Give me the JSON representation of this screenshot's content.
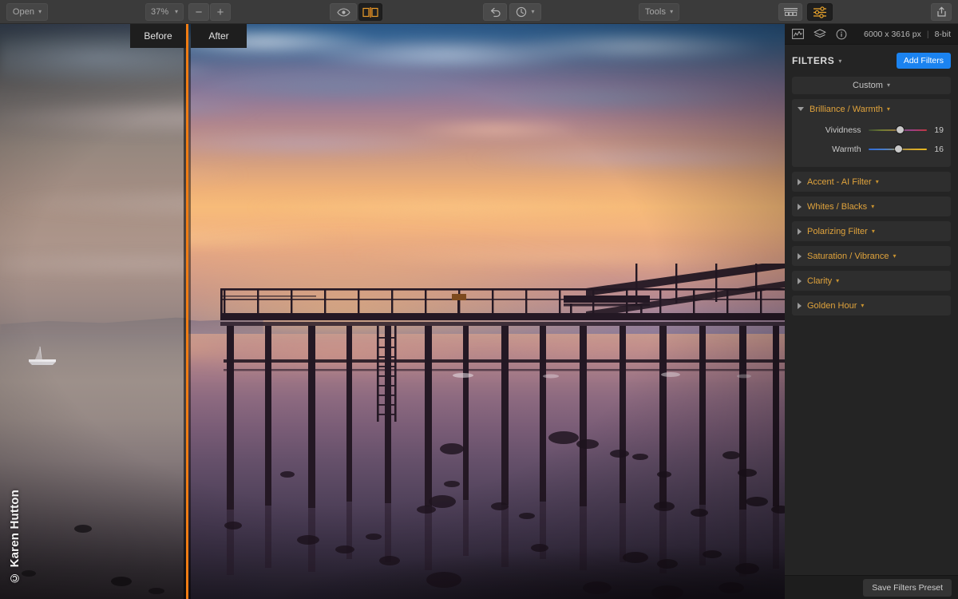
{
  "toolbar": {
    "open_label": "Open",
    "zoom_level": "37%",
    "zoom_out_label": "−",
    "zoom_in_label": "+",
    "preview_icon": "eye-icon",
    "compare_icon": "before-after-compare-icon",
    "undo_icon": "undo-arrow-icon",
    "history_icon": "history-clock-icon",
    "tools_label": "Tools",
    "presets_icon": "presets-icon",
    "filters_icon": "filters-sliders-icon",
    "share_icon": "share-export-icon"
  },
  "canvas": {
    "before_tab": "Before",
    "after_tab": "After",
    "watermark": "© Karen Hutton",
    "divider_color": "#f07c13"
  },
  "panel": {
    "icons": {
      "histogram": "histogram-icon",
      "layers": "layers-icon",
      "info": "info-icon"
    },
    "image_size": "6000 x 3616 px",
    "meta_separator": "|",
    "bit_depth": "8-bit",
    "filters_title": "FILTERS",
    "filters_title_chevron": "⌄",
    "add_filters_label": "Add Filters",
    "preset_label": "Custom",
    "preset_chevron": "⌄",
    "save_preset_label": "Save Filters Preset",
    "accent_color": "#e0a33c",
    "button_color": "#1b83f0",
    "filters": [
      {
        "name": "Brilliance / Warmth",
        "chevron": "⌄",
        "expanded": true,
        "sliders": [
          {
            "label": "Vividness",
            "value": "19",
            "percent": 55,
            "track": "vividness"
          },
          {
            "label": "Warmth",
            "value": "16",
            "percent": 52,
            "track": "warmth"
          }
        ]
      },
      {
        "name": "Accent - AI Filter",
        "chevron": "⌄",
        "expanded": false,
        "sliders": []
      },
      {
        "name": "Whites / Blacks",
        "chevron": "⌄",
        "expanded": false,
        "sliders": []
      },
      {
        "name": "Polarizing Filter",
        "chevron": "⌄",
        "expanded": false,
        "sliders": []
      },
      {
        "name": "Saturation / Vibrance",
        "chevron": "⌄",
        "expanded": false,
        "sliders": []
      },
      {
        "name": "Clarity",
        "chevron": "⌄",
        "expanded": false,
        "sliders": []
      },
      {
        "name": "Golden Hour",
        "chevron": "⌄",
        "expanded": false,
        "sliders": []
      }
    ]
  }
}
